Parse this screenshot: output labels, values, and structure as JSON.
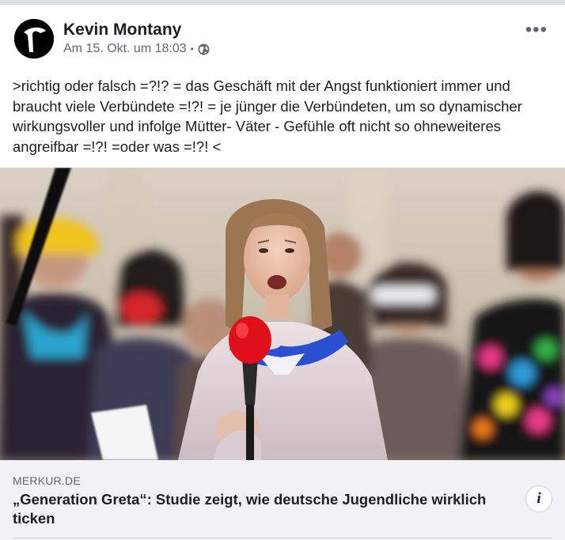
{
  "post": {
    "author": "Kevin Montany",
    "timestamp": "Am 15. Okt. um 18:03",
    "separator": "•",
    "privacy_icon": "globe-icon",
    "more_label": "•••",
    "text": ">richtig oder falsch =?!? = das Geschäft mit der Angst funktioniert immer und braucht viele Verbündete =!?! = je jünger die Verbündeten, um so dynamischer wirkungsvoller und infolge Mütter- Väter - Gefühle oft  nicht so ohneweiteres angreifbar =!?! =oder was =!?! <"
  },
  "link": {
    "domain": "MERKUR.DE",
    "title": "„Generation Greta“: Studie zeigt, wie deutsche Jugendliche wirklich ticken",
    "info_label": "i"
  },
  "colors": {
    "text": "#1c1e21",
    "meta": "#606770",
    "link_bg": "#f0f2f5",
    "microphone": "#e0101a"
  }
}
